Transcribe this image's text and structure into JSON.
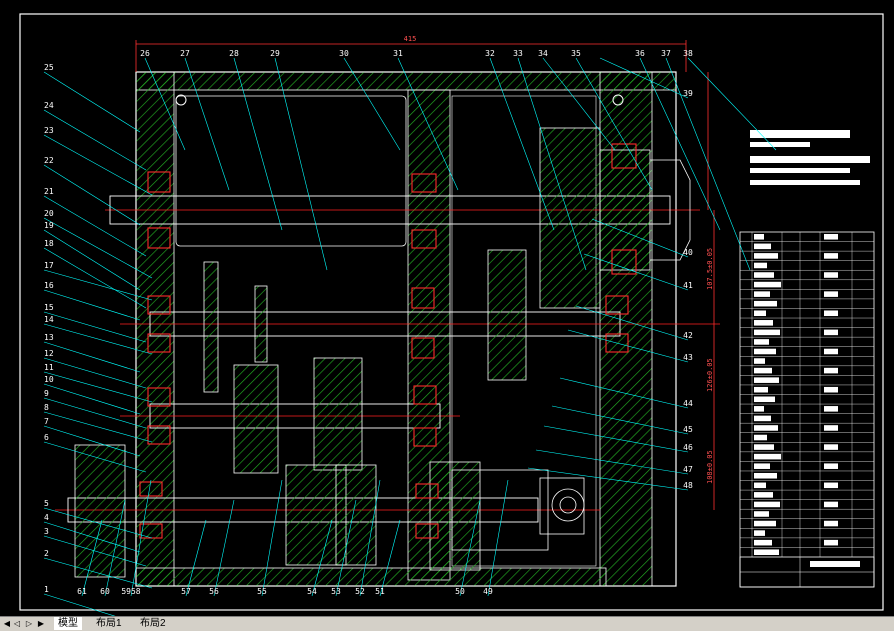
{
  "colors": {
    "background": "#000000",
    "frame": "#ffffff",
    "callout": "#00ffff",
    "centerline": "#ff2020",
    "hatch": "#22aa22",
    "part": "#ffffff",
    "dim": "#ff3030",
    "bearing": "#ff2a2a"
  },
  "callouts_left": [
    "25",
    "24",
    "23",
    "22",
    "21",
    "20",
    "19",
    "18",
    "17",
    "16",
    "15",
    "14",
    "13",
    "12",
    "11",
    "10",
    "9",
    "8",
    "7",
    "6",
    "5",
    "4",
    "3",
    "2",
    "1"
  ],
  "callouts_top": [
    "26",
    "27",
    "28",
    "29",
    "30",
    "31",
    "32",
    "33",
    "34",
    "35",
    "36",
    "37",
    "38"
  ],
  "callouts_right": [
    "39",
    "40",
    "41",
    "42",
    "43",
    "44",
    "45",
    "46",
    "47",
    "48"
  ],
  "callouts_bottom": [
    "61",
    "60",
    "5958",
    "57",
    "56",
    "55",
    "54",
    "53",
    "52",
    "51",
    "50",
    "49"
  ],
  "dimensions": {
    "top": "415",
    "right_1": "107.5±0.05",
    "right_2": "126±0.05",
    "right_3": "108±0.05"
  },
  "tabs": [
    "模型",
    "布局1",
    "布局2"
  ]
}
